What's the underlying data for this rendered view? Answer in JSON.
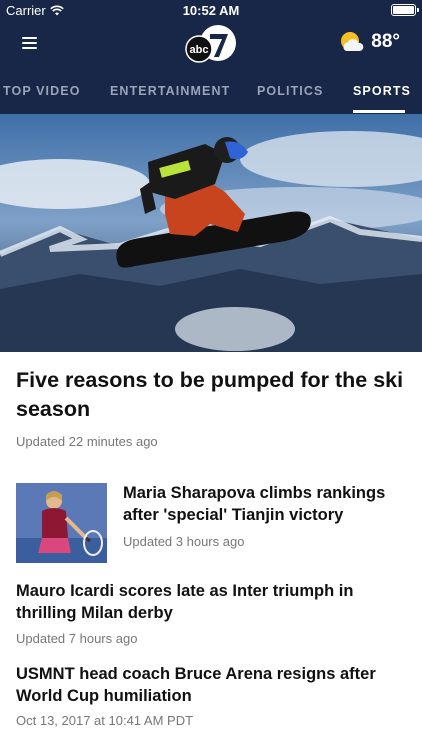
{
  "status_bar": {
    "carrier": "Carrier",
    "time": "10:52 AM"
  },
  "header": {
    "logo_number": "7",
    "logo_text": "abc",
    "temperature": "88°",
    "weather_icon": "partly-sunny-icon",
    "menu_icon": "hamburger-menu-icon"
  },
  "tabs": [
    {
      "label": "TOP VIDEO"
    },
    {
      "label": "ENTERTAINMENT"
    },
    {
      "label": "POLITICS"
    },
    {
      "label": "SPORTS",
      "active": true
    }
  ],
  "lead_story": {
    "title": "Five reasons to be pumped for the ski season",
    "meta": "Updated 22 minutes ago"
  },
  "stories": [
    {
      "title": "Maria Sharapova climbs rankings after 'special' Tianjin victory",
      "meta": "Updated 3 hours ago"
    },
    {
      "title": "Mauro Icardi scores late as Inter triumph in thrilling Milan derby",
      "meta": "Updated 7 hours ago"
    },
    {
      "title": "USMNT head coach Bruce Arena resigns after World Cup humiliation",
      "meta": "Oct 13, 2017 at 10:41 AM PDT"
    }
  ],
  "colors": {
    "header_bg": "#182748",
    "active_tab": "#ffffff",
    "inactive_tab": "#9aa3b8"
  }
}
